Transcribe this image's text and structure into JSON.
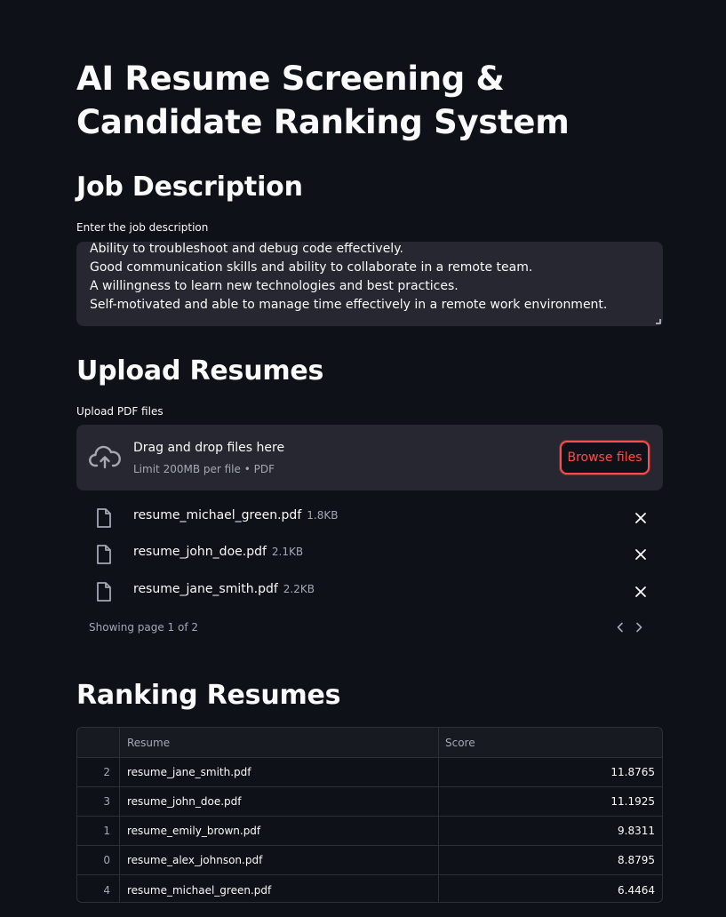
{
  "title": "AI Resume Screening & Candidate Ranking System",
  "job_section": {
    "heading": "Job Description",
    "label": "Enter the job description",
    "lines": [
      "Ability to troubleshoot and debug code effectively.",
      "Good communication skills and ability to collaborate in a remote team.",
      "A willingness to learn new technologies and best practices.",
      "Self-motivated and able to manage time effectively in a remote work environment."
    ]
  },
  "upload_section": {
    "heading": "Upload Resumes",
    "label": "Upload PDF files",
    "dropzone_title": "Drag and drop files here",
    "dropzone_sub": "Limit 200MB per file • PDF",
    "browse_label": "Browse files",
    "files": [
      {
        "name": "resume_michael_green.pdf",
        "size": "1.8KB"
      },
      {
        "name": "resume_john_doe.pdf",
        "size": "2.1KB"
      },
      {
        "name": "resume_jane_smith.pdf",
        "size": "2.2KB"
      }
    ],
    "pager_text": "Showing page 1 of 2"
  },
  "ranking_section": {
    "heading": "Ranking Resumes",
    "columns": [
      "",
      "Resume",
      "Score"
    ],
    "rows": [
      {
        "index": "2",
        "resume": "resume_jane_smith.pdf",
        "score": "11.8765"
      },
      {
        "index": "3",
        "resume": "resume_john_doe.pdf",
        "score": "11.1925"
      },
      {
        "index": "1",
        "resume": "resume_emily_brown.pdf",
        "score": "9.8311"
      },
      {
        "index": "0",
        "resume": "resume_alex_johnson.pdf",
        "score": "8.8795"
      },
      {
        "index": "4",
        "resume": "resume_michael_green.pdf",
        "score": "6.4464"
      }
    ]
  },
  "colors": {
    "background": "#0e1117",
    "panel": "#262730",
    "accent": "#ff4b4b",
    "muted": "#a3a8b4"
  }
}
